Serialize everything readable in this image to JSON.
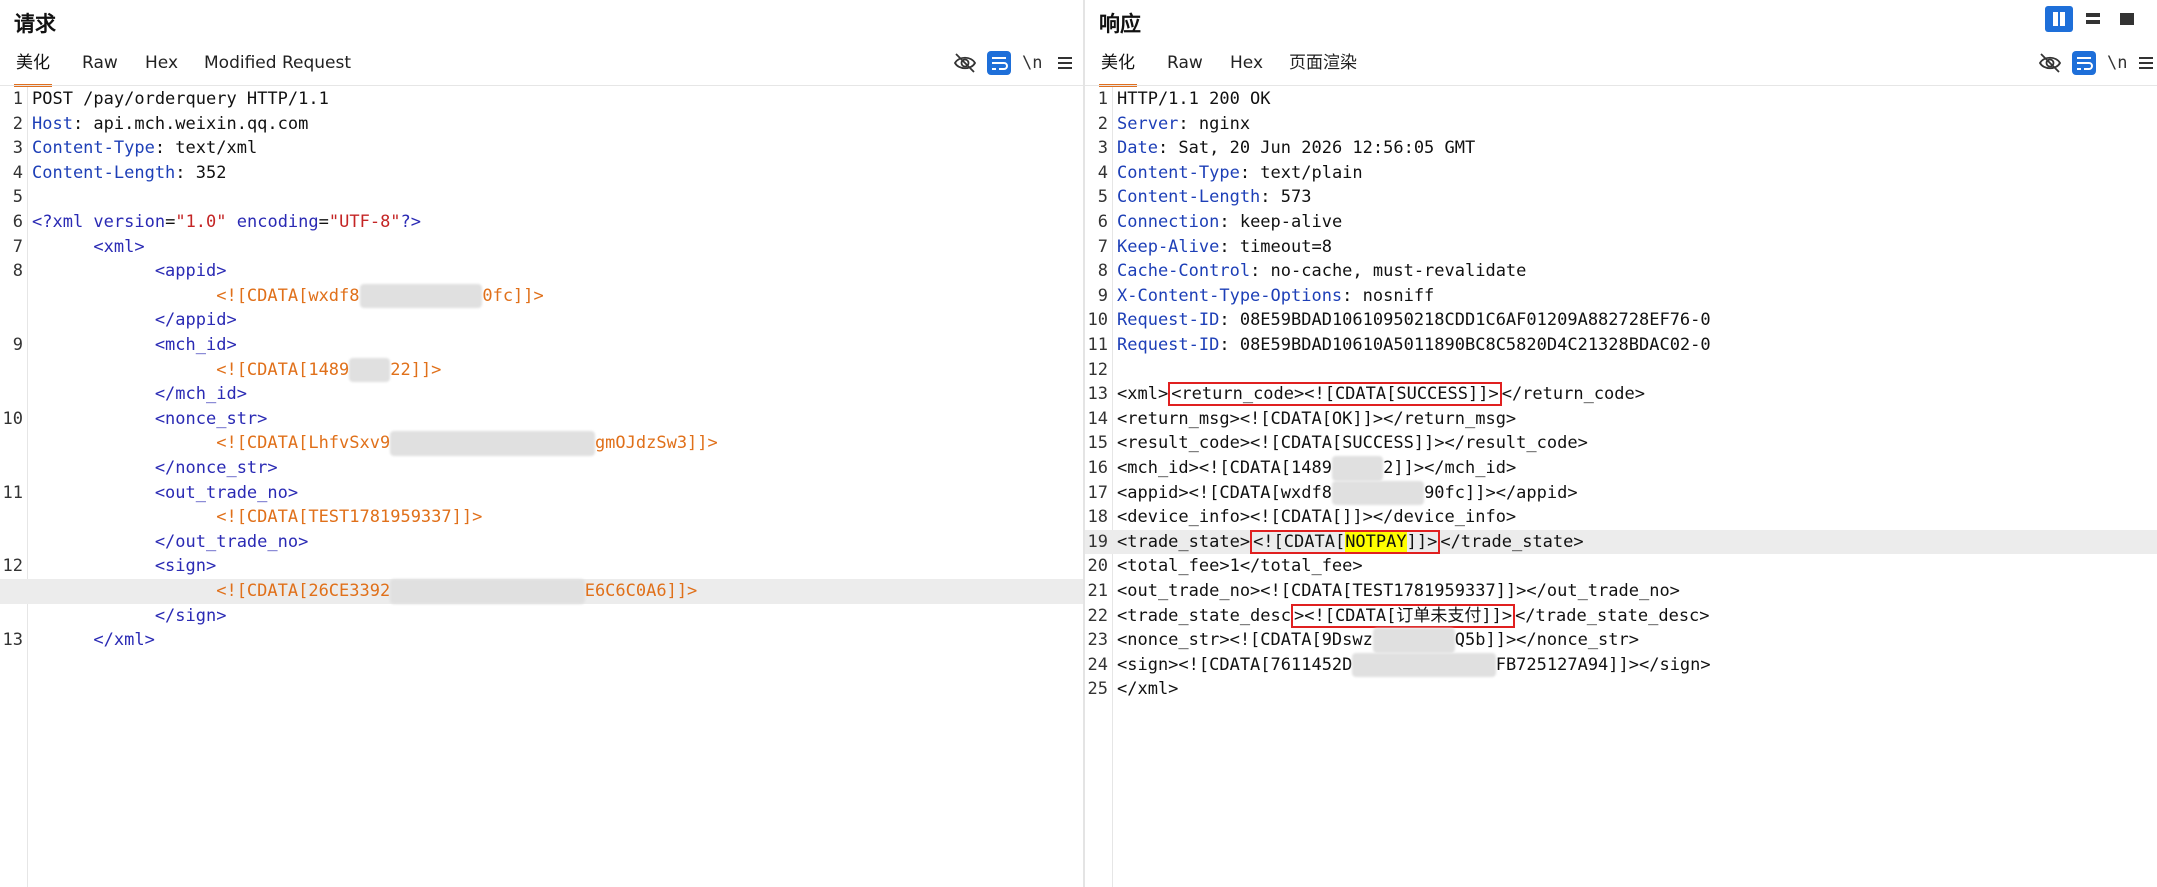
{
  "request": {
    "title": "请求",
    "tabs": [
      "美化",
      "Raw",
      "Hex",
      "Modified Request"
    ],
    "newline_label": "\\n",
    "lines": [
      {
        "n": "1",
        "segs": [
          {
            "c": "v",
            "t": "POST /pay/orderquery HTTP/1.1"
          }
        ]
      },
      {
        "n": "2",
        "segs": [
          {
            "c": "k",
            "t": "Host"
          },
          {
            "c": "v",
            "t": ": api.mch.weixin.qq.com"
          }
        ]
      },
      {
        "n": "3",
        "segs": [
          {
            "c": "k",
            "t": "Content-Type"
          },
          {
            "c": "v",
            "t": ": text/xml"
          }
        ]
      },
      {
        "n": "4",
        "segs": [
          {
            "c": "k",
            "t": "Content-Length"
          },
          {
            "c": "v",
            "t": ": 352"
          }
        ]
      },
      {
        "n": "5",
        "segs": []
      },
      {
        "n": "6",
        "segs": [
          {
            "c": "t",
            "t": "<?xml "
          },
          {
            "c": "t",
            "t": "version"
          },
          {
            "c": "v",
            "t": "="
          },
          {
            "c": "a",
            "t": "\"1.0\""
          },
          {
            "c": "t",
            "t": " encoding"
          },
          {
            "c": "v",
            "t": "="
          },
          {
            "c": "a",
            "t": "\"UTF-8\""
          },
          {
            "c": "t",
            "t": "?>"
          }
        ]
      },
      {
        "n": "7",
        "segs": [
          {
            "c": "t",
            "t": "      <xml>"
          }
        ]
      },
      {
        "n": "8",
        "segs": [
          {
            "c": "t",
            "t": "            <appid>"
          }
        ]
      },
      {
        "n": "",
        "segs": [
          {
            "c": "cd",
            "t": "                  <![CDATA[wxdf8"
          },
          {
            "c": "blur",
            "t": "XXXXXXXXXXXX"
          },
          {
            "c": "cd",
            "t": "0fc]]>"
          }
        ]
      },
      {
        "n": "",
        "segs": [
          {
            "c": "t",
            "t": "            </appid>"
          }
        ]
      },
      {
        "n": "9",
        "segs": [
          {
            "c": "t",
            "t": "            <mch_id>"
          }
        ]
      },
      {
        "n": "",
        "segs": [
          {
            "c": "cd",
            "t": "                  <![CDATA[1489"
          },
          {
            "c": "blur",
            "t": "XXXX"
          },
          {
            "c": "cd",
            "t": "22]]>"
          }
        ]
      },
      {
        "n": "",
        "segs": [
          {
            "c": "t",
            "t": "            </mch_id>"
          }
        ]
      },
      {
        "n": "10",
        "segs": [
          {
            "c": "t",
            "t": "            <nonce_str>"
          }
        ]
      },
      {
        "n": "",
        "segs": [
          {
            "c": "cd",
            "t": "                  <![CDATA[LhfvSxv9"
          },
          {
            "c": "blur",
            "t": "XXXXXXXXXXXXXXXXXXXX"
          },
          {
            "c": "cd",
            "t": "gmOJdzSw3]]>"
          }
        ]
      },
      {
        "n": "",
        "segs": [
          {
            "c": "t",
            "t": "            </nonce_str>"
          }
        ]
      },
      {
        "n": "11",
        "segs": [
          {
            "c": "t",
            "t": "            <out_trade_no>"
          }
        ]
      },
      {
        "n": "",
        "segs": [
          {
            "c": "cd",
            "t": "                  <![CDATA[TEST1781959337]]>"
          }
        ]
      },
      {
        "n": "",
        "segs": [
          {
            "c": "t",
            "t": "            </out_trade_no>"
          }
        ]
      },
      {
        "n": "12",
        "segs": [
          {
            "c": "t",
            "t": "            <sign>"
          }
        ]
      },
      {
        "n": "",
        "hl": true,
        "segs": [
          {
            "c": "cd",
            "t": "                  <![CDATA[26CE3392"
          },
          {
            "c": "blur",
            "t": "XXXXXXXXXXXXXXXXXXX"
          },
          {
            "c": "cd",
            "t": "E6C6C0A6]]>"
          }
        ]
      },
      {
        "n": "",
        "segs": [
          {
            "c": "t",
            "t": "            </sign>"
          }
        ]
      },
      {
        "n": "13",
        "segs": [
          {
            "c": "t",
            "t": "      </xml>"
          }
        ]
      }
    ]
  },
  "response": {
    "title": "响应",
    "tabs": [
      "美化",
      "Raw",
      "Hex",
      "页面渲染"
    ],
    "newline_label": "\\n",
    "lines": [
      {
        "n": "1",
        "segs": [
          {
            "c": "v",
            "t": "HTTP/1.1 200 OK"
          }
        ]
      },
      {
        "n": "2",
        "segs": [
          {
            "c": "k",
            "t": "Server"
          },
          {
            "c": "v",
            "t": ": nginx"
          }
        ]
      },
      {
        "n": "3",
        "segs": [
          {
            "c": "k",
            "t": "Date"
          },
          {
            "c": "v",
            "t": ": Sat, 20 Jun 2026 12:56:05 GMT"
          }
        ]
      },
      {
        "n": "4",
        "segs": [
          {
            "c": "k",
            "t": "Content-Type"
          },
          {
            "c": "v",
            "t": ": text/plain"
          }
        ]
      },
      {
        "n": "5",
        "segs": [
          {
            "c": "k",
            "t": "Content-Length"
          },
          {
            "c": "v",
            "t": ": 573"
          }
        ]
      },
      {
        "n": "6",
        "segs": [
          {
            "c": "k",
            "t": "Connection"
          },
          {
            "c": "v",
            "t": ": keep-alive"
          }
        ]
      },
      {
        "n": "7",
        "segs": [
          {
            "c": "k",
            "t": "Keep-Alive"
          },
          {
            "c": "v",
            "t": ": timeout=8"
          }
        ]
      },
      {
        "n": "8",
        "segs": [
          {
            "c": "k",
            "t": "Cache-Control"
          },
          {
            "c": "v",
            "t": ": no-cache, must-revalidate"
          }
        ]
      },
      {
        "n": "9",
        "segs": [
          {
            "c": "k",
            "t": "X-Content-Type-Options"
          },
          {
            "c": "v",
            "t": ": nosniff"
          }
        ]
      },
      {
        "n": "10",
        "segs": [
          {
            "c": "k",
            "t": "Request-ID"
          },
          {
            "c": "v",
            "t": ": 08E59BDAD10610950218CDD1C6AF01209A882728EF76-0"
          }
        ]
      },
      {
        "n": "11",
        "segs": [
          {
            "c": "k",
            "t": "Request-ID"
          },
          {
            "c": "v",
            "t": ": 08E59BDAD10610A5011890BC8C5820D4C21328BDAC02-0"
          }
        ]
      },
      {
        "n": "12",
        "segs": []
      },
      {
        "n": "13",
        "segs": [
          {
            "c": "rt",
            "t": "<xml>"
          },
          {
            "c": "box",
            "t": "<return_code><![CDATA[SUCCESS]]>"
          },
          {
            "c": "rt",
            "t": "</return_code>"
          }
        ]
      },
      {
        "n": "14",
        "segs": [
          {
            "c": "rt",
            "t": "<return_msg><![CDATA[OK]]></return_msg>"
          }
        ]
      },
      {
        "n": "15",
        "segs": [
          {
            "c": "rt",
            "t": "<result_code><![CDATA[SUCCESS]]></result_code>"
          }
        ]
      },
      {
        "n": "16",
        "segs": [
          {
            "c": "rt",
            "t": "<mch_id><![CDATA[1489"
          },
          {
            "c": "blur",
            "t": "XXXXX"
          },
          {
            "c": "rt",
            "t": "2]]></mch_id>"
          }
        ]
      },
      {
        "n": "17",
        "segs": [
          {
            "c": "rt",
            "t": "<appid><![CDATA[wxdf8"
          },
          {
            "c": "blur",
            "t": "XXXXXXXXX"
          },
          {
            "c": "rt",
            "t": "90fc]]></appid>"
          }
        ]
      },
      {
        "n": "18",
        "segs": [
          {
            "c": "rt",
            "t": "<device_info><![CDATA[]]></device_info>"
          }
        ]
      },
      {
        "n": "19",
        "hl": true,
        "segs": [
          {
            "c": "rt",
            "t": "<trade_state>"
          },
          {
            "c": "box",
            "t": "<![CDATA[",
            "inner": {
              "c": "yhl",
              "t": "NOTPAY"
            },
            "after": "]]>"
          },
          {
            "c": "rt",
            "t": "</trade_state>"
          }
        ]
      },
      {
        "n": "20",
        "segs": [
          {
            "c": "rt",
            "t": "<total_fee>1</total_fee>"
          }
        ]
      },
      {
        "n": "21",
        "segs": [
          {
            "c": "rt",
            "t": "<out_trade_no><![CDATA[TEST1781959337]]></out_trade_no>"
          }
        ]
      },
      {
        "n": "22",
        "segs": [
          {
            "c": "rt",
            "t": "<trade_state_desc"
          },
          {
            "c": "box",
            "t": "><![CDATA[订单未支付]]>"
          },
          {
            "c": "rt",
            "t": "</trade_state_desc>"
          }
        ]
      },
      {
        "n": "23",
        "segs": [
          {
            "c": "rt",
            "t": "<nonce_str><![CDATA[9Dswz"
          },
          {
            "c": "blur",
            "t": "XXXXXXXX"
          },
          {
            "c": "rt",
            "t": "Q5b]]></nonce_str>"
          }
        ]
      },
      {
        "n": "24",
        "segs": [
          {
            "c": "rt",
            "t": "<sign><![CDATA[7611452D"
          },
          {
            "c": "blur",
            "t": "XXXXXXXXXXXXXX"
          },
          {
            "c": "rt",
            "t": "FB725127A94]]></sign>"
          }
        ]
      },
      {
        "n": "25",
        "segs": [
          {
            "c": "rt",
            "t": "</xml>"
          }
        ]
      }
    ]
  },
  "colors": {
    "accent": "#1e6fd9",
    "tab_underline": "#e07020",
    "highlight_box": "#e02020",
    "xml_tag": "#2a2ab4",
    "cdata": "#e0701a",
    "header_key": "#1d3fb7"
  }
}
